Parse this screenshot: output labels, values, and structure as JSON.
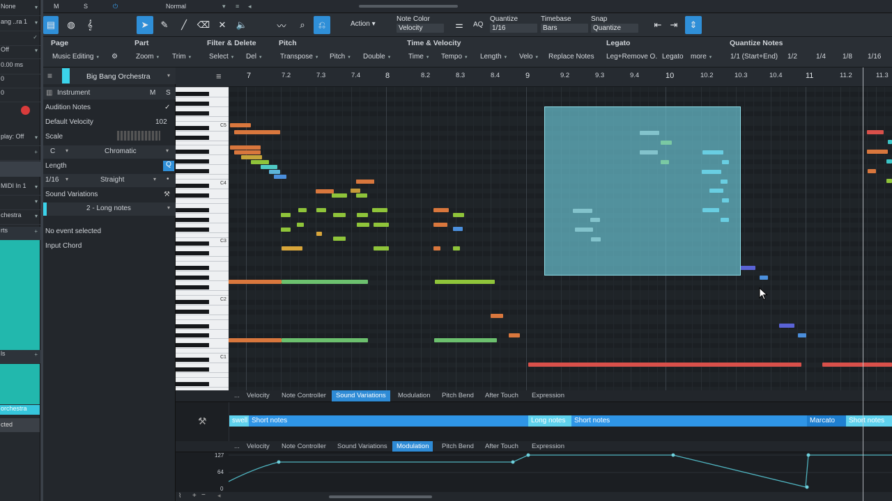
{
  "left_strip": {
    "rows": [
      "None",
      "ang ..ra 1",
      "",
      "Off",
      "0.00 ms",
      "0",
      "0",
      "",
      "play: Off",
      "",
      "MIDI In 1",
      "",
      "chestra",
      "rts",
      "",
      "",
      "",
      "ls",
      "",
      "orchestra",
      "cted"
    ]
  },
  "top_bar": {
    "m": "M",
    "s": "S",
    "mode": "Normal"
  },
  "toolbar": {
    "action_label": "Action",
    "note_color_label": "Note Color",
    "note_color_value": "Velocity",
    "aq_label": "AQ",
    "quantize_label": "Quantize",
    "quantize_value": "1/16",
    "timebase_label": "Timebase",
    "timebase_value": "Bars",
    "snap_label": "Snap",
    "snap_value": "Quantize"
  },
  "sections": {
    "headers": [
      "Page",
      "Part",
      "Filter & Delete",
      "Pitch",
      "Time & Velocity",
      "Legato",
      "Quantize Notes"
    ],
    "buttons": [
      "Music Editing",
      "Zoom",
      "Trim",
      "Select",
      "Del",
      "Transpose",
      "Pitch",
      "Double",
      "Time",
      "Tempo",
      "Length",
      "Velo",
      "Replace Notes",
      "Leg+Remove O.",
      "Legato",
      "more",
      "1/1 (Start+End)",
      "1/2",
      "1/4",
      "1/8",
      "1/16"
    ]
  },
  "inspector": {
    "track_name": "Big Bang Orchestra",
    "instrument_label": "Instrument",
    "m": "M",
    "s": "S",
    "audition_label": "Audition Notes",
    "default_velocity_label": "Default Velocity",
    "default_velocity_value": "102",
    "scale_label": "Scale",
    "scale_root": "C",
    "scale_type": "Chromatic",
    "length_label": "Length",
    "length_value": "1/16",
    "length_mode": "Straight",
    "sound_variations_label": "Sound Variations",
    "sound_variation_value": "2 - Long notes",
    "no_event": "No event selected",
    "input_chord": "Input Chord"
  },
  "ruler": {
    "ticks": [
      "7",
      "7.2",
      "7.3",
      "7.4",
      "8",
      "8.2",
      "8.3",
      "8.4",
      "9",
      "9.2",
      "9.3",
      "9.4",
      "10",
      "10.2",
      "10.3",
      "10.4",
      "11",
      "11.2",
      "11.3"
    ]
  },
  "keys": {
    "labels": [
      "C5",
      "C4",
      "C3",
      "C2",
      "C1"
    ]
  },
  "lane_tabs": [
    "...",
    "Velocity",
    "Note Controller",
    "Sound Variations",
    "Modulation",
    "Pitch Bend",
    "After Touch",
    "Expression"
  ],
  "sound_variations_lane": {
    "items": [
      "swell",
      "Short notes",
      "Long notes",
      "Short notes",
      "Marcato",
      "Short notes"
    ]
  },
  "modulation_lane": {
    "scale": [
      "127",
      "64",
      "0"
    ]
  },
  "colors": {
    "accent": "#2f95e6",
    "selection": "#6ecddc",
    "note_orange": "#d9773d",
    "note_green": "#8fc43a",
    "note_red": "#d9504a"
  }
}
